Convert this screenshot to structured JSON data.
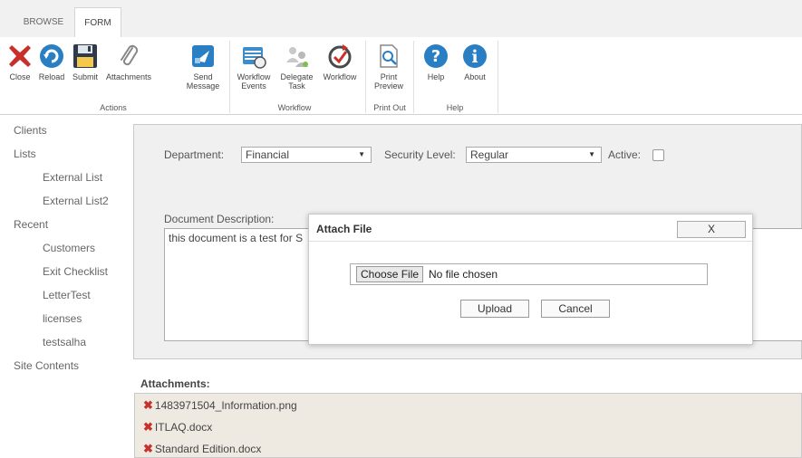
{
  "tabs": [
    "BROWSE",
    "FORM"
  ],
  "ribbon": {
    "buttons": {
      "close": "Close",
      "reload": "Reload",
      "submit": "Submit",
      "attachments": "Attachments",
      "send_message_1": "Send",
      "send_message_2": "Message",
      "workflow_events_1": "Workflow",
      "workflow_events_2": "Events",
      "delegate_task_1": "Delegate",
      "delegate_task_2": "Task",
      "workflow": "Workflow",
      "print_preview_1": "Print",
      "print_preview_2": "Preview",
      "help": "Help",
      "about": "About"
    },
    "groups": {
      "actions": "Actions",
      "workflow": "Workflow",
      "print_out": "Print Out",
      "help": "Help"
    }
  },
  "sidebar": {
    "items": [
      {
        "label": "Clients"
      },
      {
        "label": "Lists"
      },
      {
        "label": "External List"
      },
      {
        "label": "External List2"
      },
      {
        "label": "Recent"
      },
      {
        "label": "Customers"
      },
      {
        "label": "Exit Checklist"
      },
      {
        "label": "LetterTest"
      },
      {
        "label": "licenses"
      },
      {
        "label": "testsalha"
      },
      {
        "label": "Site Contents"
      }
    ]
  },
  "form": {
    "department_label": "Department:",
    "department_value": "Financial",
    "security_label": "Security Level:",
    "security_value": "Regular",
    "active_label": "Active:",
    "description_label": "Document Description:",
    "description_value": "this document is a test for S"
  },
  "attachments": {
    "title": "Attachments:",
    "files": [
      "1483971504_Information.png",
      "ITLAQ.docx",
      "Standard Edition.docx"
    ]
  },
  "modal": {
    "title": "Attach File",
    "close_label": "X",
    "choose_file": "Choose File",
    "file_status": "No file chosen",
    "upload": "Upload",
    "cancel": "Cancel"
  },
  "colors": {
    "close_red": "#c9302c",
    "accent_blue": "#2a7fc4",
    "submit_dark": "#2f3b4c"
  }
}
